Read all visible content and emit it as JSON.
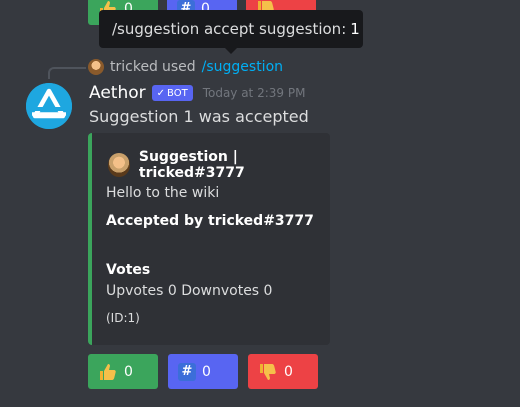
{
  "tooltip": {
    "command": "/suggestion accept suggestion:",
    "value": "1"
  },
  "previous_reactions": [
    {
      "icon": "thumbs-up-icon",
      "count": "0",
      "color": "#3ba55c"
    },
    {
      "icon": "hash-icon",
      "count": "0",
      "color": "#5865f2"
    },
    {
      "icon": "thumbs-down-icon",
      "count": "",
      "color": "#ed4245"
    }
  ],
  "message": {
    "reply": {
      "user": "tricked",
      "used_text": "used",
      "command": "/suggestion"
    },
    "author": "Aethor",
    "bot_badge": "BOT",
    "timestamp": "Today at 2:39 PM",
    "content": "Suggestion 1 was accepted",
    "embed": {
      "accent_color": "#3ba55c",
      "author": "Suggestion | tricked#3777",
      "description": "Hello to the wiki",
      "accepted_by": "Accepted by tricked#3777",
      "field_name": "Votes",
      "field_value": "Upvotes 0 Downvotes 0",
      "footer": "(ID:1)"
    },
    "reactions": [
      {
        "icon": "thumbs-up-icon",
        "count": "0",
        "color": "#3ba55c"
      },
      {
        "icon": "hash-icon",
        "count": "0",
        "color": "#5865f2"
      },
      {
        "icon": "thumbs-down-icon",
        "count": "0",
        "color": "#ed4245"
      }
    ]
  }
}
